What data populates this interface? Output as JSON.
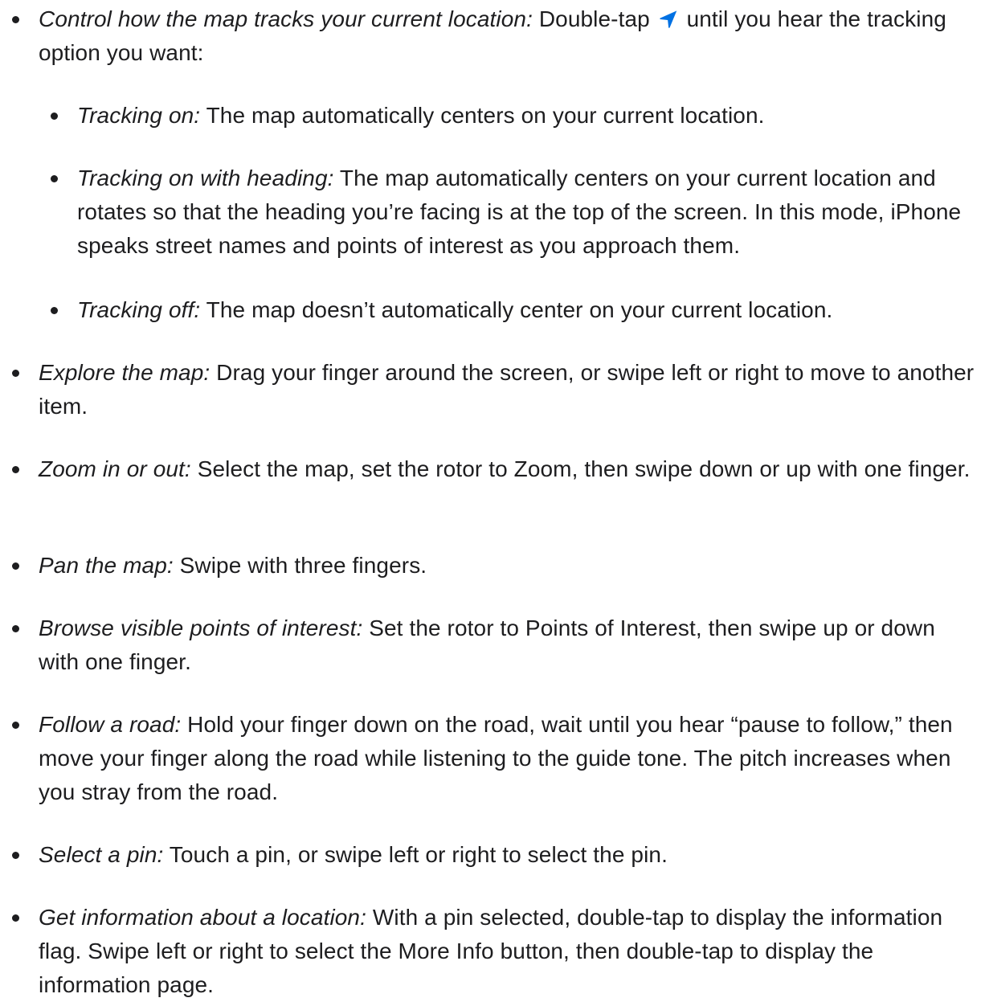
{
  "items": [
    {
      "term": "Control how the map tracks your current location:",
      "text_before": " Double-tap ",
      "icon": "location-arrow-icon",
      "text_after": " until you hear the tracking option you want:"
    },
    {
      "term": "Tracking on:",
      "text": " The map automatically centers on your current location."
    },
    {
      "term": "Tracking on with heading:",
      "text": " The map automatically centers on your current location and rotates so that the heading you’re facing is at the top of the screen. In this mode, iPhone speaks street names and points of interest as you approach them."
    },
    {
      "term": "Tracking off:",
      "text": " The map doesn’t automatically center on your current location."
    },
    {
      "term": "Explore the map:",
      "text": " Drag your finger around the screen, or swipe left or right to move to another item."
    },
    {
      "term": "Zoom in or out:",
      "text": " Select the map, set the rotor to Zoom, then swipe down or up with one finger."
    },
    {
      "term": "Pan the map:",
      "text": " Swipe with three fingers."
    },
    {
      "term": "Browse visible points of interest:",
      "text": " Set the rotor to Points of Interest, then swipe up or down with one finger."
    },
    {
      "term": "Follow a road:",
      "text": " Hold your finger down on the road, wait until you hear “pause to follow,” then move your finger along the road while listening to the guide tone. The pitch increases when you stray from the road."
    },
    {
      "term": "Select a pin:",
      "text": " Touch a pin, or swipe left or right to select the pin."
    },
    {
      "term": "Get information about a location:",
      "text": " With a pin selected, double-tap to display the information flag. Swipe left or right to select the More Info button, then double-tap to display the information page."
    }
  ],
  "colors": {
    "text": "#1d1d1f",
    "accent": "#0071e3"
  }
}
